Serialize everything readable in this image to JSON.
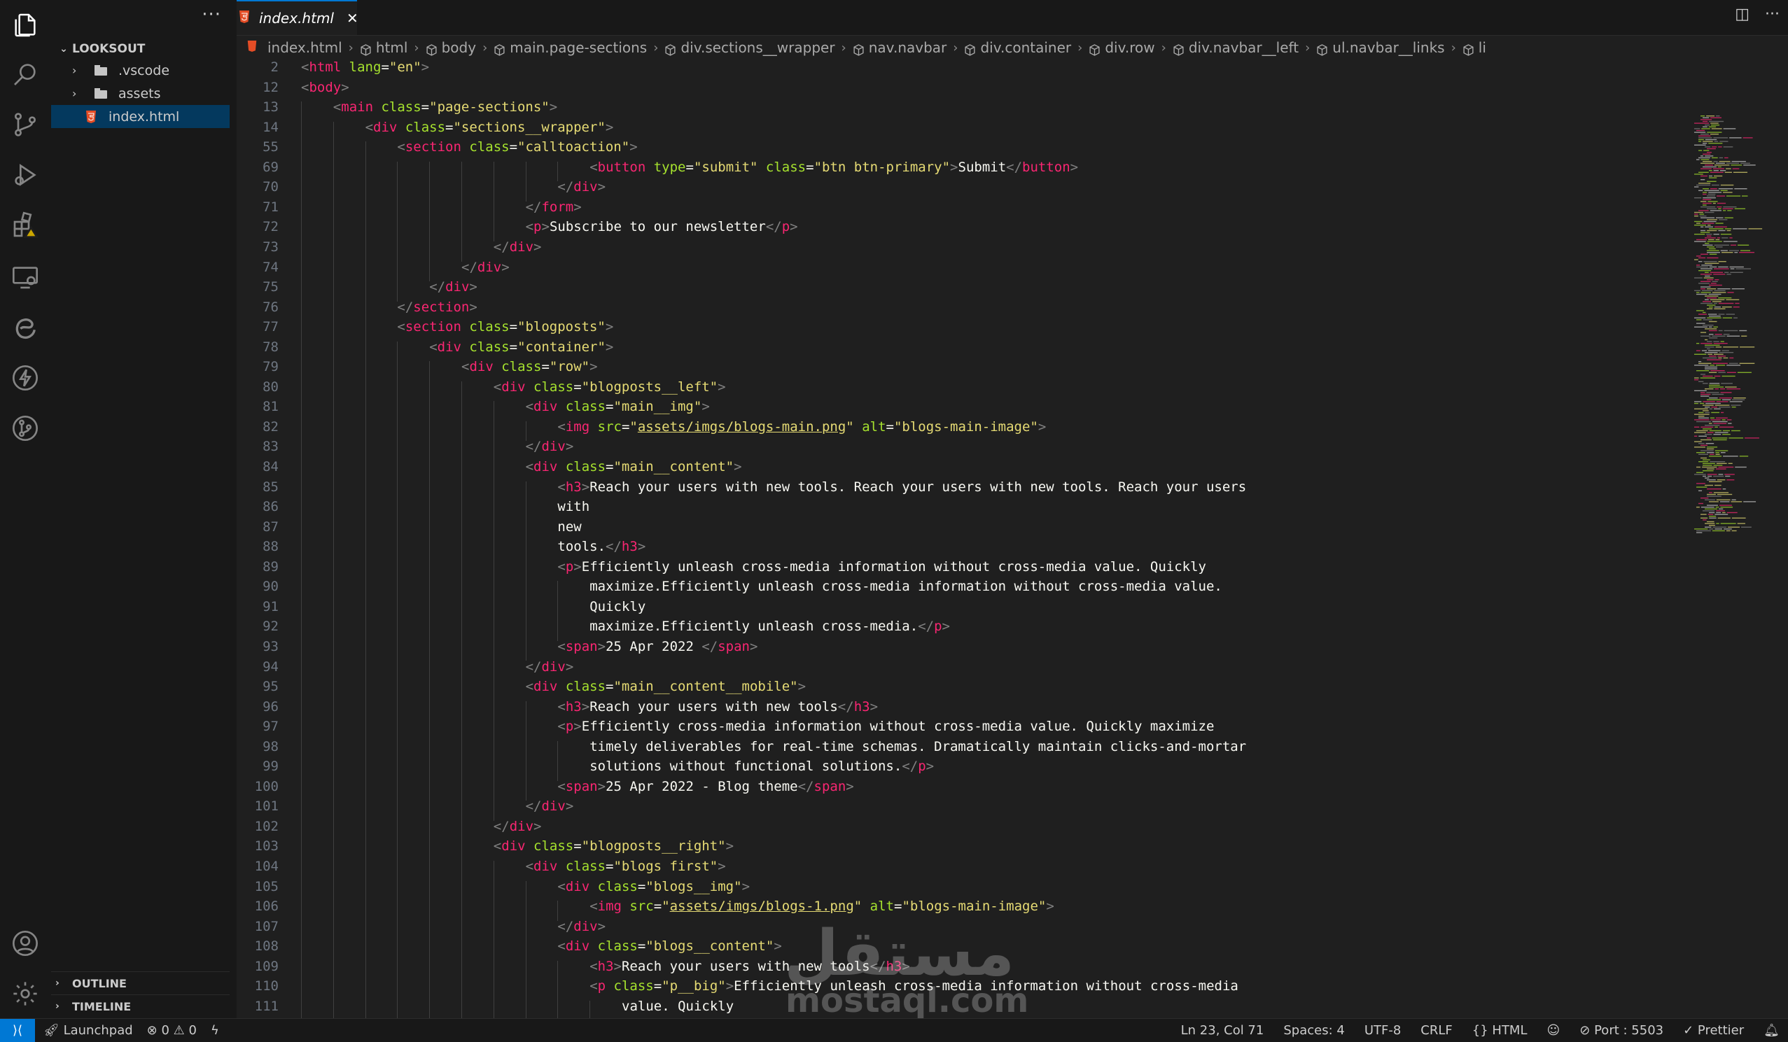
{
  "explorer": {
    "root": "LOOKSOUT",
    "items": [
      {
        "label": ".vscode",
        "type": "folder"
      },
      {
        "label": "assets",
        "type": "folder"
      },
      {
        "label": "index.html",
        "type": "file",
        "selected": true
      }
    ],
    "sections": [
      "OUTLINE",
      "TIMELINE"
    ]
  },
  "tab": {
    "label": "index.html",
    "close": "✕"
  },
  "breadcrumb": [
    "index.html",
    "html",
    "body",
    "main.page-sections",
    "div.sections__wrapper",
    "nav.navbar",
    "div.container",
    "div.row",
    "div.navbar__left",
    "ul.navbar__links",
    "li"
  ],
  "code": {
    "lines": [
      {
        "n": "2",
        "indent": 0,
        "text": "<html lang=\"en\">"
      },
      {
        "n": "12",
        "indent": 0,
        "text": "<body>"
      },
      {
        "n": "13",
        "indent": 1,
        "text": "<main class=\"page-sections\">"
      },
      {
        "n": "14",
        "indent": 2,
        "text": "<div class=\"sections__wrapper\">"
      },
      {
        "n": "55",
        "indent": 3,
        "text": "<section class=\"calltoaction\">"
      },
      {
        "n": "69",
        "indent": 9,
        "text": "<button type=\"submit\" class=\"btn btn-primary\">Submit</button>"
      },
      {
        "n": "70",
        "indent": 8,
        "text": "</div>"
      },
      {
        "n": "71",
        "indent": 7,
        "text": "</form>"
      },
      {
        "n": "72",
        "indent": 7,
        "text": "<p>Subscribe to our newsletter</p>"
      },
      {
        "n": "73",
        "indent": 6,
        "text": "</div>"
      },
      {
        "n": "74",
        "indent": 5,
        "text": "</div>"
      },
      {
        "n": "75",
        "indent": 4,
        "text": "</div>"
      },
      {
        "n": "76",
        "indent": 3,
        "text": "</section>"
      },
      {
        "n": "77",
        "indent": 3,
        "text": "<section class=\"blogposts\">"
      },
      {
        "n": "78",
        "indent": 4,
        "text": "<div class=\"container\">"
      },
      {
        "n": "79",
        "indent": 5,
        "text": "<div class=\"row\">"
      },
      {
        "n": "80",
        "indent": 6,
        "text": "<div class=\"blogposts__left\">"
      },
      {
        "n": "81",
        "indent": 7,
        "text": "<div class=\"main__img\">"
      },
      {
        "n": "82",
        "indent": 8,
        "text": "<img src=\"assets/imgs/blogs-main.png\" alt=\"blogs-main-image\">"
      },
      {
        "n": "83",
        "indent": 7,
        "text": "</div>"
      },
      {
        "n": "84",
        "indent": 7,
        "text": "<div class=\"main__content\">"
      },
      {
        "n": "85",
        "indent": 8,
        "text": "<h3>Reach your users with new tools. Reach your users with new tools. Reach your users"
      },
      {
        "n": "86",
        "indent": 8,
        "text": "with"
      },
      {
        "n": "87",
        "indent": 8,
        "text": "new"
      },
      {
        "n": "88",
        "indent": 8,
        "text": "tools.</h3>"
      },
      {
        "n": "89",
        "indent": 8,
        "text": "<p>Efficiently unleash cross-media information without cross-media value. Quickly"
      },
      {
        "n": "90",
        "indent": 9,
        "text": "maximize.Efficiently unleash cross-media information without cross-media value."
      },
      {
        "n": "91",
        "indent": 9,
        "text": "Quickly"
      },
      {
        "n": "92",
        "indent": 9,
        "text": "maximize.Efficiently unleash cross-media.</p>"
      },
      {
        "n": "93",
        "indent": 8,
        "text": "<span>25 Apr 2022 </span>"
      },
      {
        "n": "94",
        "indent": 7,
        "text": "</div>"
      },
      {
        "n": "95",
        "indent": 7,
        "text": "<div class=\"main__content__mobile\">"
      },
      {
        "n": "96",
        "indent": 8,
        "text": "<h3>Reach your users with new tools</h3>"
      },
      {
        "n": "97",
        "indent": 8,
        "text": "<p>Efficiently cross-media information without cross-media value. Quickly maximize"
      },
      {
        "n": "98",
        "indent": 9,
        "text": "timely deliverables for real-time schemas. Dramatically maintain clicks-and-mortar"
      },
      {
        "n": "99",
        "indent": 9,
        "text": "solutions without functional solutions.</p>"
      },
      {
        "n": "100",
        "indent": 8,
        "text": "<span>25 Apr 2022 - Blog theme</span>"
      },
      {
        "n": "101",
        "indent": 7,
        "text": "</div>"
      },
      {
        "n": "102",
        "indent": 6,
        "text": "</div>"
      },
      {
        "n": "103",
        "indent": 6,
        "text": "<div class=\"blogposts__right\">"
      },
      {
        "n": "104",
        "indent": 7,
        "text": "<div class=\"blogs first\">"
      },
      {
        "n": "105",
        "indent": 8,
        "text": "<div class=\"blogs__img\">"
      },
      {
        "n": "106",
        "indent": 9,
        "text": "<img src=\"assets/imgs/blogs-1.png\" alt=\"blogs-main-image\">"
      },
      {
        "n": "107",
        "indent": 8,
        "text": "</div>"
      },
      {
        "n": "108",
        "indent": 8,
        "text": "<div class=\"blogs__content\">"
      },
      {
        "n": "109",
        "indent": 9,
        "text": "<h3>Reach your users with new tools</h3>"
      },
      {
        "n": "110",
        "indent": 9,
        "text": "<p class=\"p__big\">Efficiently unleash cross-media information without cross-media"
      },
      {
        "n": "111",
        "indent": 10,
        "text": "value. Quickly"
      }
    ]
  },
  "statusbar": {
    "left": [
      "Launchpad",
      "0",
      "0"
    ],
    "right": [
      "Ln 23, Col 71",
      "Spaces: 4",
      "UTF-8",
      "CRLF",
      "HTML",
      "Port : 5503",
      "Prettier"
    ]
  },
  "watermark": {
    "arabic": "مستقل",
    "latin": "mostaql.com"
  },
  "colors": {
    "accent": "#0078d4",
    "selection": "#04395e",
    "tag": "#f92672",
    "attr": "#a6e22e",
    "string": "#e6db74",
    "warning": "#cca700"
  }
}
